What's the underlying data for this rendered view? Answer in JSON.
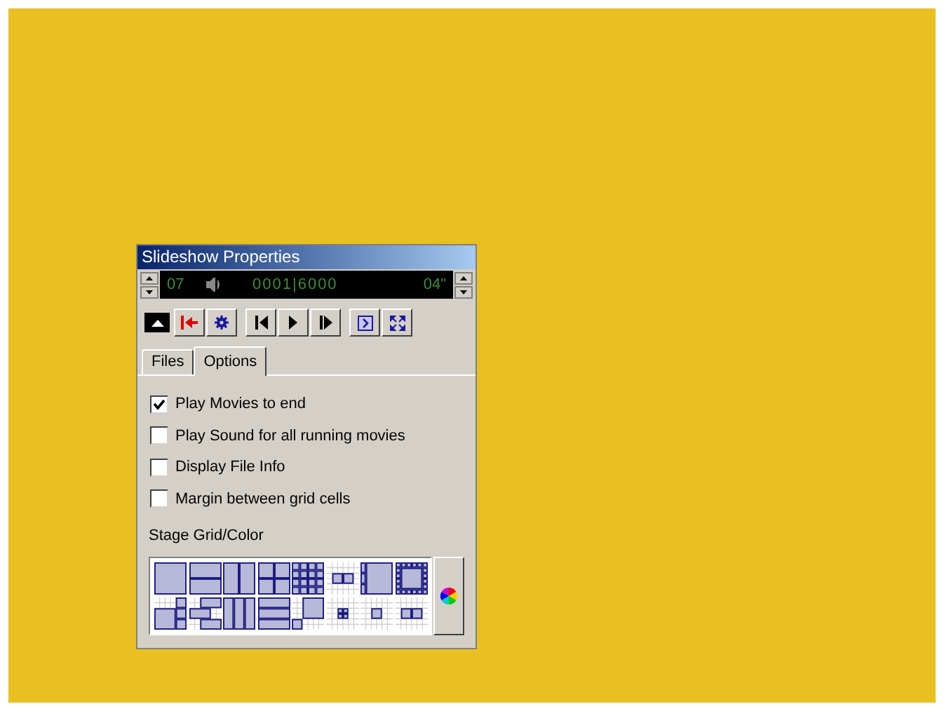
{
  "window": {
    "title": "Slideshow Properties"
  },
  "display": {
    "slide": "07",
    "counter": "0001|6000",
    "duration": "04\""
  },
  "tabs": [
    {
      "label": "Files",
      "selected": false
    },
    {
      "label": "Options",
      "selected": true
    }
  ],
  "options": [
    {
      "label": "Play Movies to end",
      "checked": true
    },
    {
      "label": "Play Sound for all running movies",
      "checked": false
    },
    {
      "label": "Display File Info",
      "checked": false
    },
    {
      "label": "Margin between grid cells",
      "checked": false
    }
  ],
  "stage_grid": {
    "label": "Stage Grid/Color"
  }
}
